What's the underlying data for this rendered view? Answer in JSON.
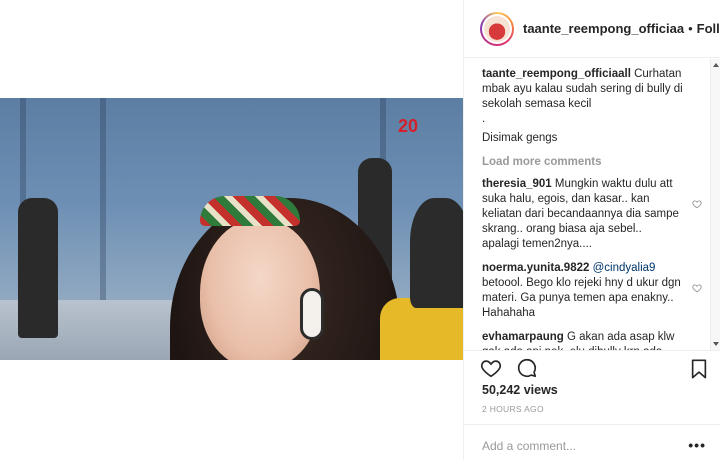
{
  "post": {
    "username": "taante_reempong_officiaa",
    "dot": "•",
    "follow_label": "Following"
  },
  "caption": {
    "username": "taante_reempong_officiaall",
    "text": "Curhatan mbak ayu kalau sudah sering di bully di sekolah semasa kecil",
    "line2": ".",
    "line3": "Disimak gengs"
  },
  "comments": {
    "load_more": "Load more comments",
    "items": [
      {
        "username": "theresia_901",
        "text": "Mungkin waktu dulu att suka halu, egois, dan kasar.. kan keliatan dari becandaannya dia sampe skrang.. orang biasa aja sebel.. apalagi temen2nya...."
      },
      {
        "username": "noerma.yunita.9822",
        "mention": "@cindyalia9",
        "text": "betoool. Bego klo rejeki hny d ukur dgn materi. Ga punya temen apa enakny.. Hahahaha"
      },
      {
        "username": "evhamarpaung",
        "text": "G akan ada asap klw gak ada api pok. elu dibully krn ada sebab nyaa, mkanya introopeksi dong pok, to elu suka mya dibully yg pnting"
      }
    ]
  },
  "stats": {
    "views": "50,242 views",
    "time": "2 HOURS AGO"
  },
  "add_comment": {
    "placeholder": "Add a comment...",
    "more": "•••"
  },
  "video": {
    "badge": "20"
  }
}
